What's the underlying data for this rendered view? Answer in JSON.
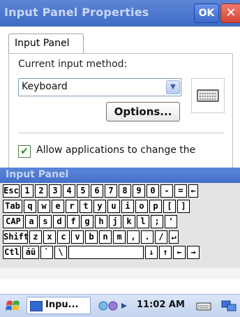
{
  "window": {
    "title": "Input Panel Properties",
    "ok_label": "OK",
    "close_label": "✕"
  },
  "tabs": [
    {
      "label": "Input Panel"
    }
  ],
  "settings": {
    "current_method_label": "Current input method:",
    "current_method_value": "Keyboard",
    "options_button": "Options...",
    "allow_change_label": "Allow applications to change the",
    "allow_change_checked": true
  },
  "input_panel": {
    "title": "Input Panel",
    "rows": [
      [
        "Esc",
        "1",
        "2",
        "3",
        "4",
        "5",
        "6",
        "7",
        "8",
        "9",
        "0",
        "-",
        "=",
        "←"
      ],
      [
        "Tab",
        "q",
        "w",
        "e",
        "r",
        "t",
        "y",
        "u",
        "i",
        "o",
        "p",
        "[",
        "]"
      ],
      [
        "CAP",
        "a",
        "s",
        "d",
        "f",
        "g",
        "h",
        "j",
        "k",
        "l",
        ";",
        "'"
      ],
      [
        "Shift",
        "z",
        "x",
        "c",
        "v",
        "b",
        "n",
        "m",
        ",",
        ".",
        "/",
        "↵"
      ],
      [
        "Ctl",
        "áü",
        "`",
        "\\",
        " ",
        "↓",
        "↑",
        "←",
        "→"
      ]
    ]
  },
  "taskbar": {
    "task_label": "Inpu...",
    "clock": "11:02 AM"
  },
  "colors": {
    "title_bar": "#3f6bc4",
    "ok_button": "#3b69cc",
    "close_button": "#d44533",
    "checkbox_check": "#2c8a2c"
  }
}
